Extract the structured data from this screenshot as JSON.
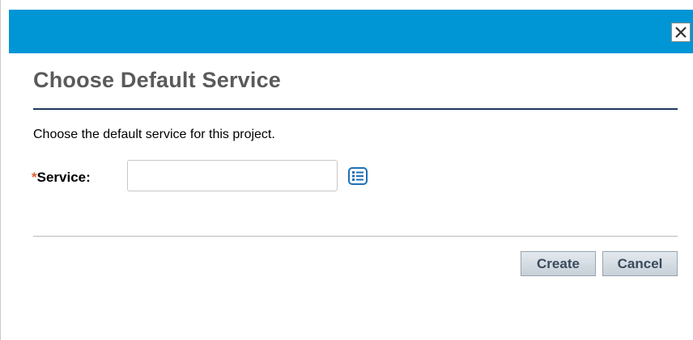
{
  "dialog": {
    "title": "Choose Default Service",
    "description": "Choose the default service for this project.",
    "close_icon": "close-icon"
  },
  "form": {
    "required_marker": "*",
    "service_label": "Service:",
    "service_value": "",
    "service_placeholder": "",
    "lookup_icon": "list-lookup-icon"
  },
  "actions": {
    "create_label": "Create",
    "cancel_label": "Cancel"
  },
  "colors": {
    "titlebar": "#0096d6",
    "title_text": "#5a5a5a",
    "title_rule": "#1f3a5c",
    "required_marker": "#e06030",
    "button_text": "#3a4a5c",
    "lookup_icon": "#1f6fb5"
  }
}
